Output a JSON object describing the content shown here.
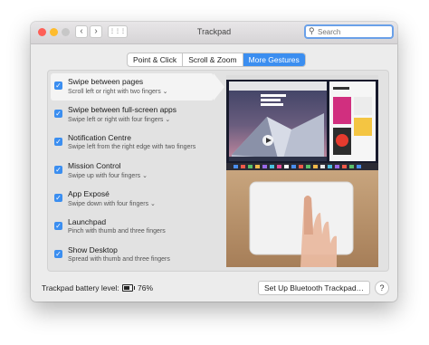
{
  "window": {
    "title": "Trackpad"
  },
  "traffic_lights": {
    "close_color": "#fe5f57",
    "minimize_color": "#febc2e",
    "zoom_color": "#c7c7c7"
  },
  "nav": {
    "back_glyph": "‹",
    "forward_glyph": "›",
    "grid_glyph": "⋮⋮⋮"
  },
  "search": {
    "placeholder": "Search",
    "value": ""
  },
  "tabs": [
    {
      "label": "Point & Click",
      "active": false
    },
    {
      "label": "Scroll & Zoom",
      "active": false
    },
    {
      "label": "More Gestures",
      "active": true
    }
  ],
  "gestures": [
    {
      "name": "Swipe between pages",
      "description": "Scroll left or right with two fingers ⌄",
      "checked": true,
      "selected": true
    },
    {
      "name": "Swipe between full-screen apps",
      "description": "Swipe left or right with four fingers ⌄",
      "checked": true,
      "selected": false
    },
    {
      "name": "Notification Centre",
      "description": "Swipe left from the right edge with two fingers",
      "checked": true,
      "selected": false
    },
    {
      "name": "Mission Control",
      "description": "Swipe up with four fingers ⌄",
      "checked": true,
      "selected": false
    },
    {
      "name": "App Exposé",
      "description": "Swipe down with four fingers ⌄",
      "checked": true,
      "selected": false
    },
    {
      "name": "Launchpad",
      "description": "Pinch with thumb and three fingers",
      "checked": true,
      "selected": false
    },
    {
      "name": "Show Desktop",
      "description": "Spread with thumb and three fingers",
      "checked": true,
      "selected": false
    }
  ],
  "battery": {
    "label": "Trackpad battery level:",
    "percent": "76%",
    "level": 0.76
  },
  "bluetooth_button": {
    "label": "Set Up Bluetooth Trackpad…"
  },
  "help": {
    "label": "?"
  },
  "accent_color": "#3b8ef0"
}
